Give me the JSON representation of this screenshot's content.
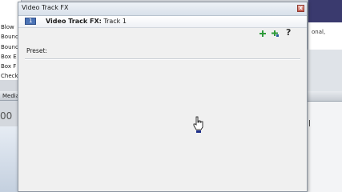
{
  "background": {
    "list_items": [
      "Blow",
      "Bounc",
      "Bounc",
      "Box E",
      "Box F",
      "Check"
    ],
    "media_tab_label": "Media",
    "timecode_fragment": "00",
    "right_text": "onal,"
  },
  "dialog": {
    "title": "Video Track FX",
    "close_symbol": "x",
    "track_badge_number": "1",
    "header_bold": "Video Track FX:",
    "header_value": " Track 1",
    "help_symbol": "?",
    "preset_label": "Preset:"
  },
  "colors": {
    "dialog_bg": "#f0f0f0",
    "track_badge": "#4b73b6",
    "plugin_icon_green": "#2e9a3a",
    "close_button": "#c6584a"
  },
  "icons": [
    "close-icon",
    "track-icon",
    "plugin-add-icon",
    "plugin-chain-icon",
    "help-icon",
    "hand-cursor-icon"
  ]
}
